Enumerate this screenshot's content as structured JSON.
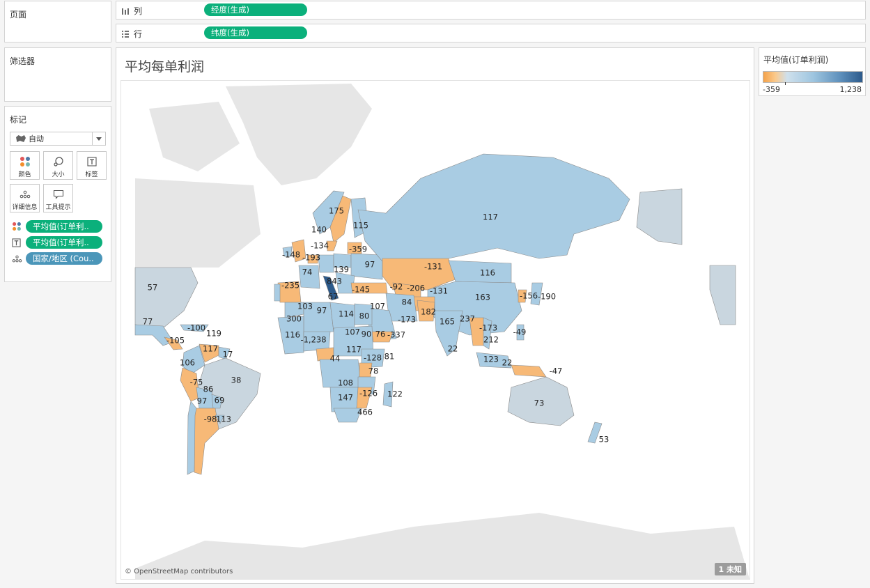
{
  "pages_card": {
    "title": "页面"
  },
  "filters_card": {
    "title": "筛选器"
  },
  "marks_card": {
    "title": "标记",
    "mark_type": "自动",
    "buttons": [
      {
        "label": "颜色",
        "icon": "color-icon"
      },
      {
        "label": "大小",
        "icon": "size-icon"
      },
      {
        "label": "标签",
        "icon": "label-icon"
      },
      {
        "label": "详细信息",
        "icon": "detail-icon"
      },
      {
        "label": "工具提示",
        "icon": "tooltip-icon"
      }
    ],
    "pills": [
      {
        "icon": "color-icon",
        "text": "平均值(订单利..",
        "color": "#0bb07b"
      },
      {
        "icon": "label-icon",
        "text": "平均值(订单利..",
        "color": "#0bb07b"
      },
      {
        "icon": "detail-icon",
        "text": "国家/地区 (Cou..",
        "color": "#4b96b9"
      }
    ]
  },
  "columns_shelf": {
    "label": "列",
    "pill": "经度(生成)"
  },
  "rows_shelf": {
    "label": "行",
    "pill": "纬度(生成)"
  },
  "sheet": {
    "title": "平均每单利润"
  },
  "map": {
    "attribution": "© OpenStreetMap contributors",
    "unknown_badge": "1 未知",
    "colors": {
      "negative": "#f7b977",
      "positive": "#a9cce3",
      "neutral": "#c9d6df",
      "strong": "#2c5a8b",
      "background_land": "#e6e6e6"
    }
  },
  "legend": {
    "title": "平均值(订单利润)",
    "min_label": "-359",
    "max_label": "1,238"
  },
  "chart_data": {
    "type": "choropleth",
    "title": "平均每单利润",
    "measure": "平均值(订单利润)",
    "color_range": [
      -359,
      1238
    ],
    "labels": [
      "175",
      "140",
      "115",
      "-134",
      "-359",
      "-148",
      "-193",
      "139",
      "74",
      "843",
      "-235",
      "97",
      "-145",
      "-131",
      "117",
      "116",
      "103",
      "97",
      "67",
      "107",
      "-92",
      "-206",
      "84",
      "-131",
      "163",
      "-156",
      "-190",
      "300",
      "114",
      "80",
      "-173",
      "182",
      "165",
      "237",
      "-173",
      "-49",
      "116",
      "-1,238",
      "107",
      "90",
      "76",
      "-337",
      "117",
      "-128",
      "81",
      "44",
      "78",
      "212",
      "123",
      "22",
      "-47",
      "108",
      "147",
      "-126",
      "122",
      "466",
      "73",
      "53",
      "57",
      "77",
      "-100",
      "119",
      "-105",
      "117",
      "17",
      "106",
      "-75",
      "38",
      "86",
      "97",
      "69",
      "-98",
      "113",
      "22"
    ]
  }
}
